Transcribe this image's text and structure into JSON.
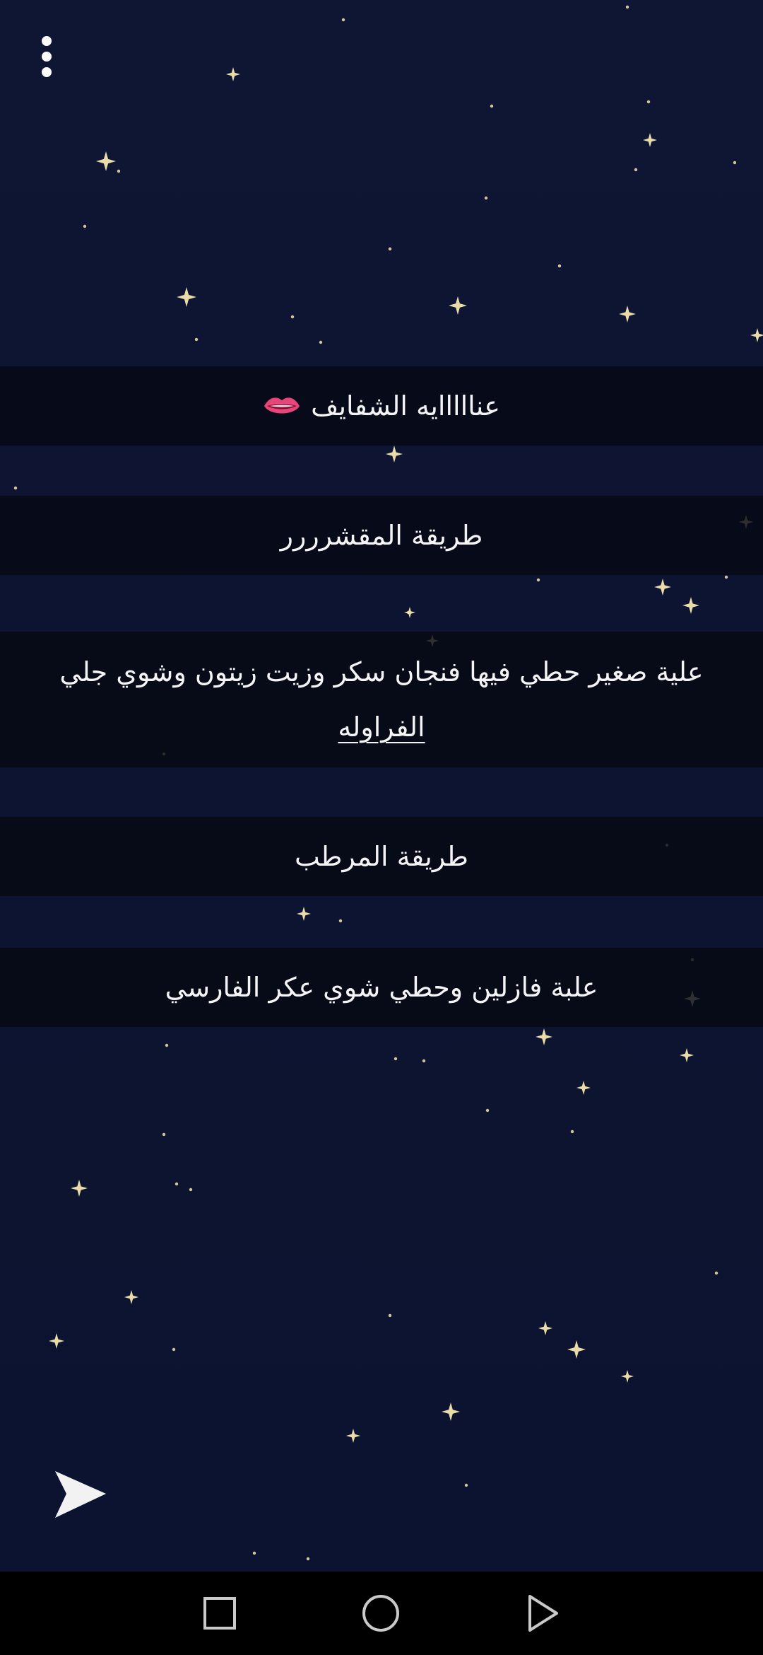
{
  "icons": {
    "menu": "more-vertical-icon",
    "lips": "lips-emoji-icon",
    "send": "send-icon",
    "recents": "square-recents-icon",
    "home": "circle-home-icon",
    "back": "triangle-back-icon"
  },
  "colors": {
    "background": "#0e1430",
    "band": "#06080f",
    "text": "#f4f4f6",
    "star": "#f6e7b0",
    "lips": "#e8457a"
  },
  "list": {
    "items": [
      {
        "text": "عنااااايه الشفايف"
      },
      {
        "text": "طريقة المقشرررر"
      },
      {
        "line1": "علية صغير حطي فيها فنجان سكر وزيت زيتون  وشوي جلي",
        "line2": "الفراوله"
      },
      {
        "text": "طريقة المرطب"
      },
      {
        "text": "علبة فازلين وحطي شوي عكر الفارسي"
      }
    ]
  }
}
